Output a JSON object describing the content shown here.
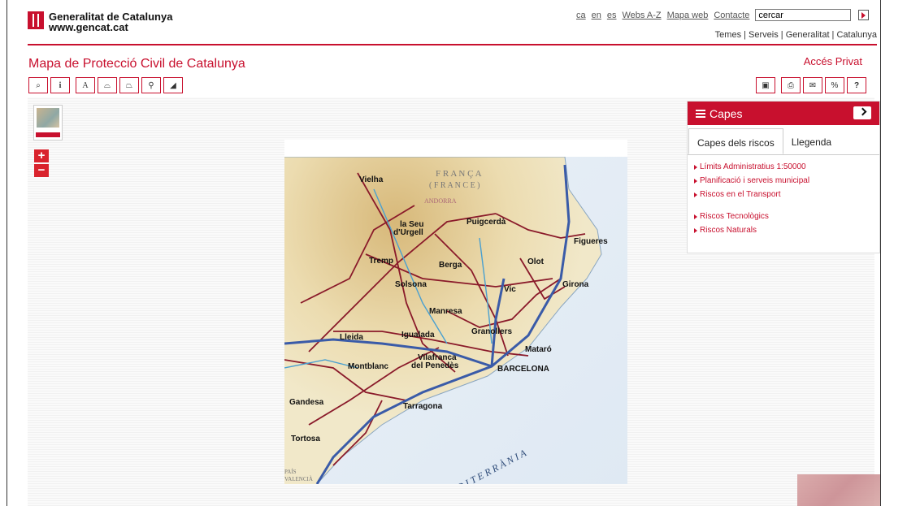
{
  "header": {
    "org_name": "Generalitat de Catalunya",
    "org_url": "www.gencat.cat",
    "langs": [
      "ca",
      "en",
      "es"
    ],
    "links": [
      "Webs A-Z",
      "Mapa web",
      "Contacte"
    ],
    "search_value": "cercar",
    "subnav": "Temes | Serveis | Generalitat | Catalunya"
  },
  "page": {
    "title": "Mapa de Protecció Civil de Catalunya",
    "private_link": "Accés Privat"
  },
  "toolbar_left": [
    {
      "name": "search-tool",
      "glyph": "⌕"
    },
    {
      "name": "info-tool",
      "glyph": "i"
    },
    {
      "name": "text-tool",
      "glyph": "A"
    },
    {
      "name": "measure-distance-tool",
      "glyph": "⌓"
    },
    {
      "name": "measure-area-tool",
      "glyph": "⏢"
    },
    {
      "name": "marker-tool",
      "glyph": "⚲"
    },
    {
      "name": "eraser-tool",
      "glyph": "◢"
    }
  ],
  "toolbar_right": [
    {
      "name": "save-tool",
      "glyph": "▣"
    },
    {
      "name": "print-tool",
      "glyph": "⎙"
    },
    {
      "name": "email-tool",
      "glyph": "✉"
    },
    {
      "name": "link-tool",
      "glyph": "%"
    },
    {
      "name": "help-tool",
      "glyph": "?"
    }
  ],
  "zoom": {
    "in": "+",
    "out": "−"
  },
  "panel": {
    "title": "Capes",
    "tabs": [
      "Capes dels riscos",
      "Llegenda"
    ],
    "layers": [
      "Límits Administratius 1:50000",
      "Planificació i serveis municipal",
      "Riscos en el Transport",
      "Riscos Tecnològics",
      "Riscos Naturals"
    ]
  },
  "map": {
    "country_label": "F R A N Ç A",
    "country_label2": "( F R A N C E )",
    "andorra": "ANDORRA",
    "sea": "M A R   M E D I T E R R À N I A",
    "valencia1": "PAÍS",
    "valencia2": "VALENCIÀ",
    "cities": [
      "Vielha",
      "la Seu",
      "d'Urgell",
      "Puigcerdà",
      "Figueres",
      "Tremp",
      "Berga",
      "Olot",
      "Solsona",
      "Vic",
      "Girona",
      "Manresa",
      "Lleida",
      "Igualada",
      "Granollers",
      "Mataró",
      "Vilafranca",
      "del Penedès",
      "Montblanc",
      "BARCELONA",
      "Gandesa",
      "Tarragona",
      "Tortosa"
    ]
  }
}
